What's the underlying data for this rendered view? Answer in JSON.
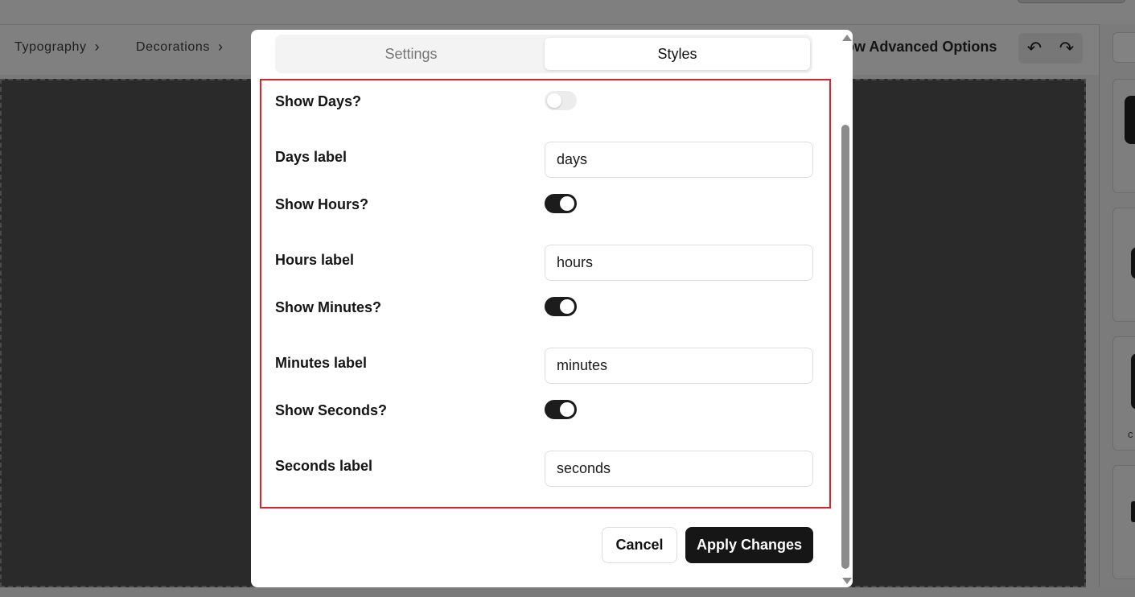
{
  "background": {
    "breadcrumbs": [
      "Typography",
      "Decorations"
    ],
    "advanced_options_label": "how Advanced Options",
    "undo_icon": "undo-icon",
    "redo_icon": "redo-icon",
    "right_card_text": "c"
  },
  "modal": {
    "tabs": [
      {
        "label": "Settings",
        "active": false
      },
      {
        "label": "Styles",
        "active": true
      }
    ],
    "rows": {
      "show_days": {
        "label": "Show Days?",
        "on": false
      },
      "days_label": {
        "label": "Days label",
        "value": "days"
      },
      "show_hours": {
        "label": "Show Hours?",
        "on": true
      },
      "hours_label": {
        "label": "Hours label",
        "value": "hours"
      },
      "show_minutes": {
        "label": "Show Minutes?",
        "on": true
      },
      "minutes_label": {
        "label": "Minutes label",
        "value": "minutes"
      },
      "show_seconds": {
        "label": "Show Seconds?",
        "on": true
      },
      "seconds_label": {
        "label": "Seconds label",
        "value": "seconds"
      }
    },
    "cancel_label": "Cancel",
    "apply_label": "Apply Changes"
  },
  "colors": {
    "highlight_border": "#e0202a",
    "toggle_on": "#1c1c1c",
    "toggle_off": "#ececec",
    "apply_button": "#161616"
  }
}
